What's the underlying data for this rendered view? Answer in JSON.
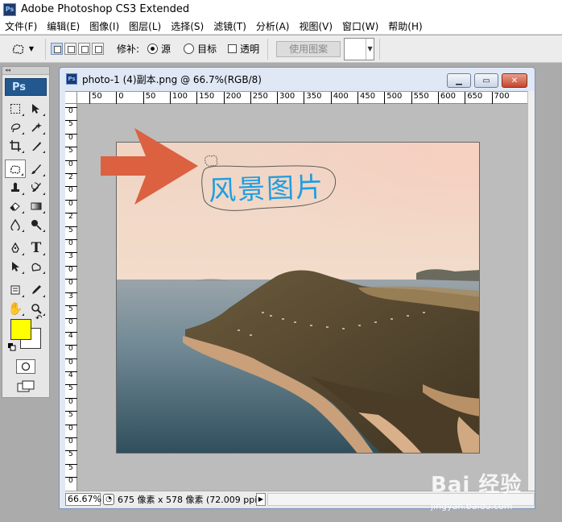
{
  "window": {
    "title": "Adobe Photoshop CS3 Extended",
    "icon": "Ps"
  },
  "menu": [
    "文件(F)",
    "编辑(E)",
    "图像(I)",
    "图层(L)",
    "选择(S)",
    "滤镜(T)",
    "分析(A)",
    "视图(V)",
    "窗口(W)",
    "帮助(H)"
  ],
  "options": {
    "patch_label": "修补:",
    "source_label": "源",
    "source_checked": true,
    "destination_label": "目标",
    "transparent_label": "透明",
    "use_pattern_label": "使用图案"
  },
  "toolbox": {
    "logo": "Ps",
    "foreground_color": "#ffff00",
    "background_color": "#ffffff"
  },
  "document": {
    "title": "photo-1 (4)副本.png @ 66.7%(RGB/8)",
    "ruler_h": [
      "50",
      "0",
      "50",
      "100",
      "150",
      "200",
      "250",
      "300",
      "350",
      "400",
      "450",
      "500",
      "550",
      "600",
      "650",
      "700"
    ],
    "ruler_v": [
      "0",
      "5",
      "0",
      "5",
      "0",
      "2",
      "0",
      "0",
      "2",
      "5",
      "0",
      "3",
      "0",
      "0",
      "3",
      "5",
      "0",
      "4",
      "0",
      "0",
      "4",
      "5",
      "0",
      "5",
      "0",
      "0",
      "5",
      "5",
      "0"
    ],
    "annotation_text": "风景图片",
    "arrow_color": "#db6140",
    "annotation_color": "#1f9ee0"
  },
  "status": {
    "zoom": "66.67%",
    "info": "675 像素 x 578 像素 (72.009 ppi)"
  },
  "watermark": {
    "text": "Bai 经验",
    "sub": "jingyan.baidu.com"
  }
}
